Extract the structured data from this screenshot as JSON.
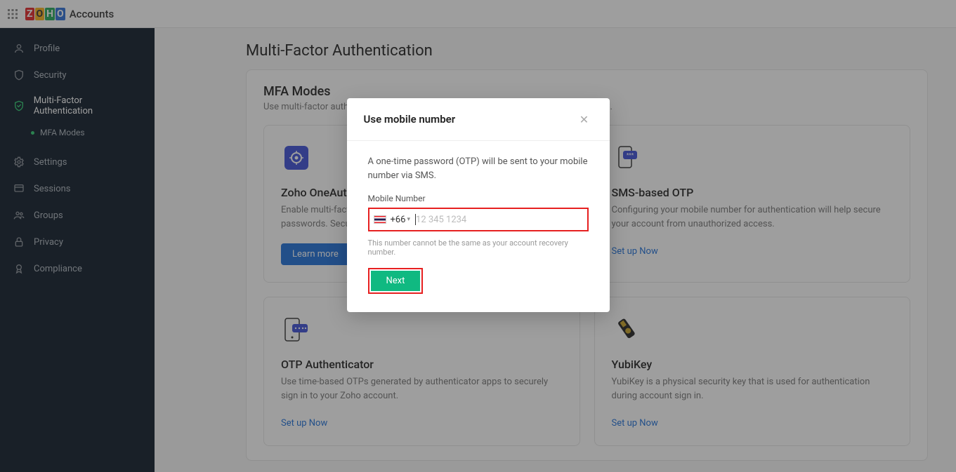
{
  "header": {
    "product": "Accounts"
  },
  "sidebar": {
    "items": [
      {
        "label": "Profile"
      },
      {
        "label": "Security"
      },
      {
        "label": "Multi-Factor Authentication"
      },
      {
        "label": "Settings"
      },
      {
        "label": "Sessions"
      },
      {
        "label": "Groups"
      },
      {
        "label": "Privacy"
      },
      {
        "label": "Compliance"
      }
    ],
    "sub": "MFA Modes"
  },
  "page": {
    "title": "Multi-Factor Authentication",
    "panel_title": "MFA Modes",
    "panel_sub": "Use multi-factor authentication (MFA) to add an extra layer of security to your account."
  },
  "cards": {
    "oneauth": {
      "title": "Zoho OneAuth",
      "desc": "Enable multi-factor authentication, and manage your online accounts' passwords. Secure your Zoho account with OneAuth now.",
      "button": "Learn more"
    },
    "sms": {
      "title": "SMS-based OTP",
      "desc": "Configuring your mobile number for authentication will help secure your account from unauthorized access.",
      "link": "Set up Now"
    },
    "otp": {
      "title": "OTP Authenticator",
      "desc": "Use time-based OTPs generated by authenticator apps to securely sign in to your Zoho account.",
      "link": "Set up Now"
    },
    "yubi": {
      "title": "YubiKey",
      "desc": "YubiKey is a physical security key that is used for authentication during account sign in.",
      "link": "Set up Now"
    }
  },
  "modal": {
    "title": "Use mobile number",
    "text": "A one-time password (OTP) will be sent to your mobile number via SMS.",
    "field_label": "Mobile Number",
    "country_code": "+66",
    "placeholder": "12 345 1234",
    "note": "This number cannot be the same as your account recovery number.",
    "next": "Next"
  }
}
